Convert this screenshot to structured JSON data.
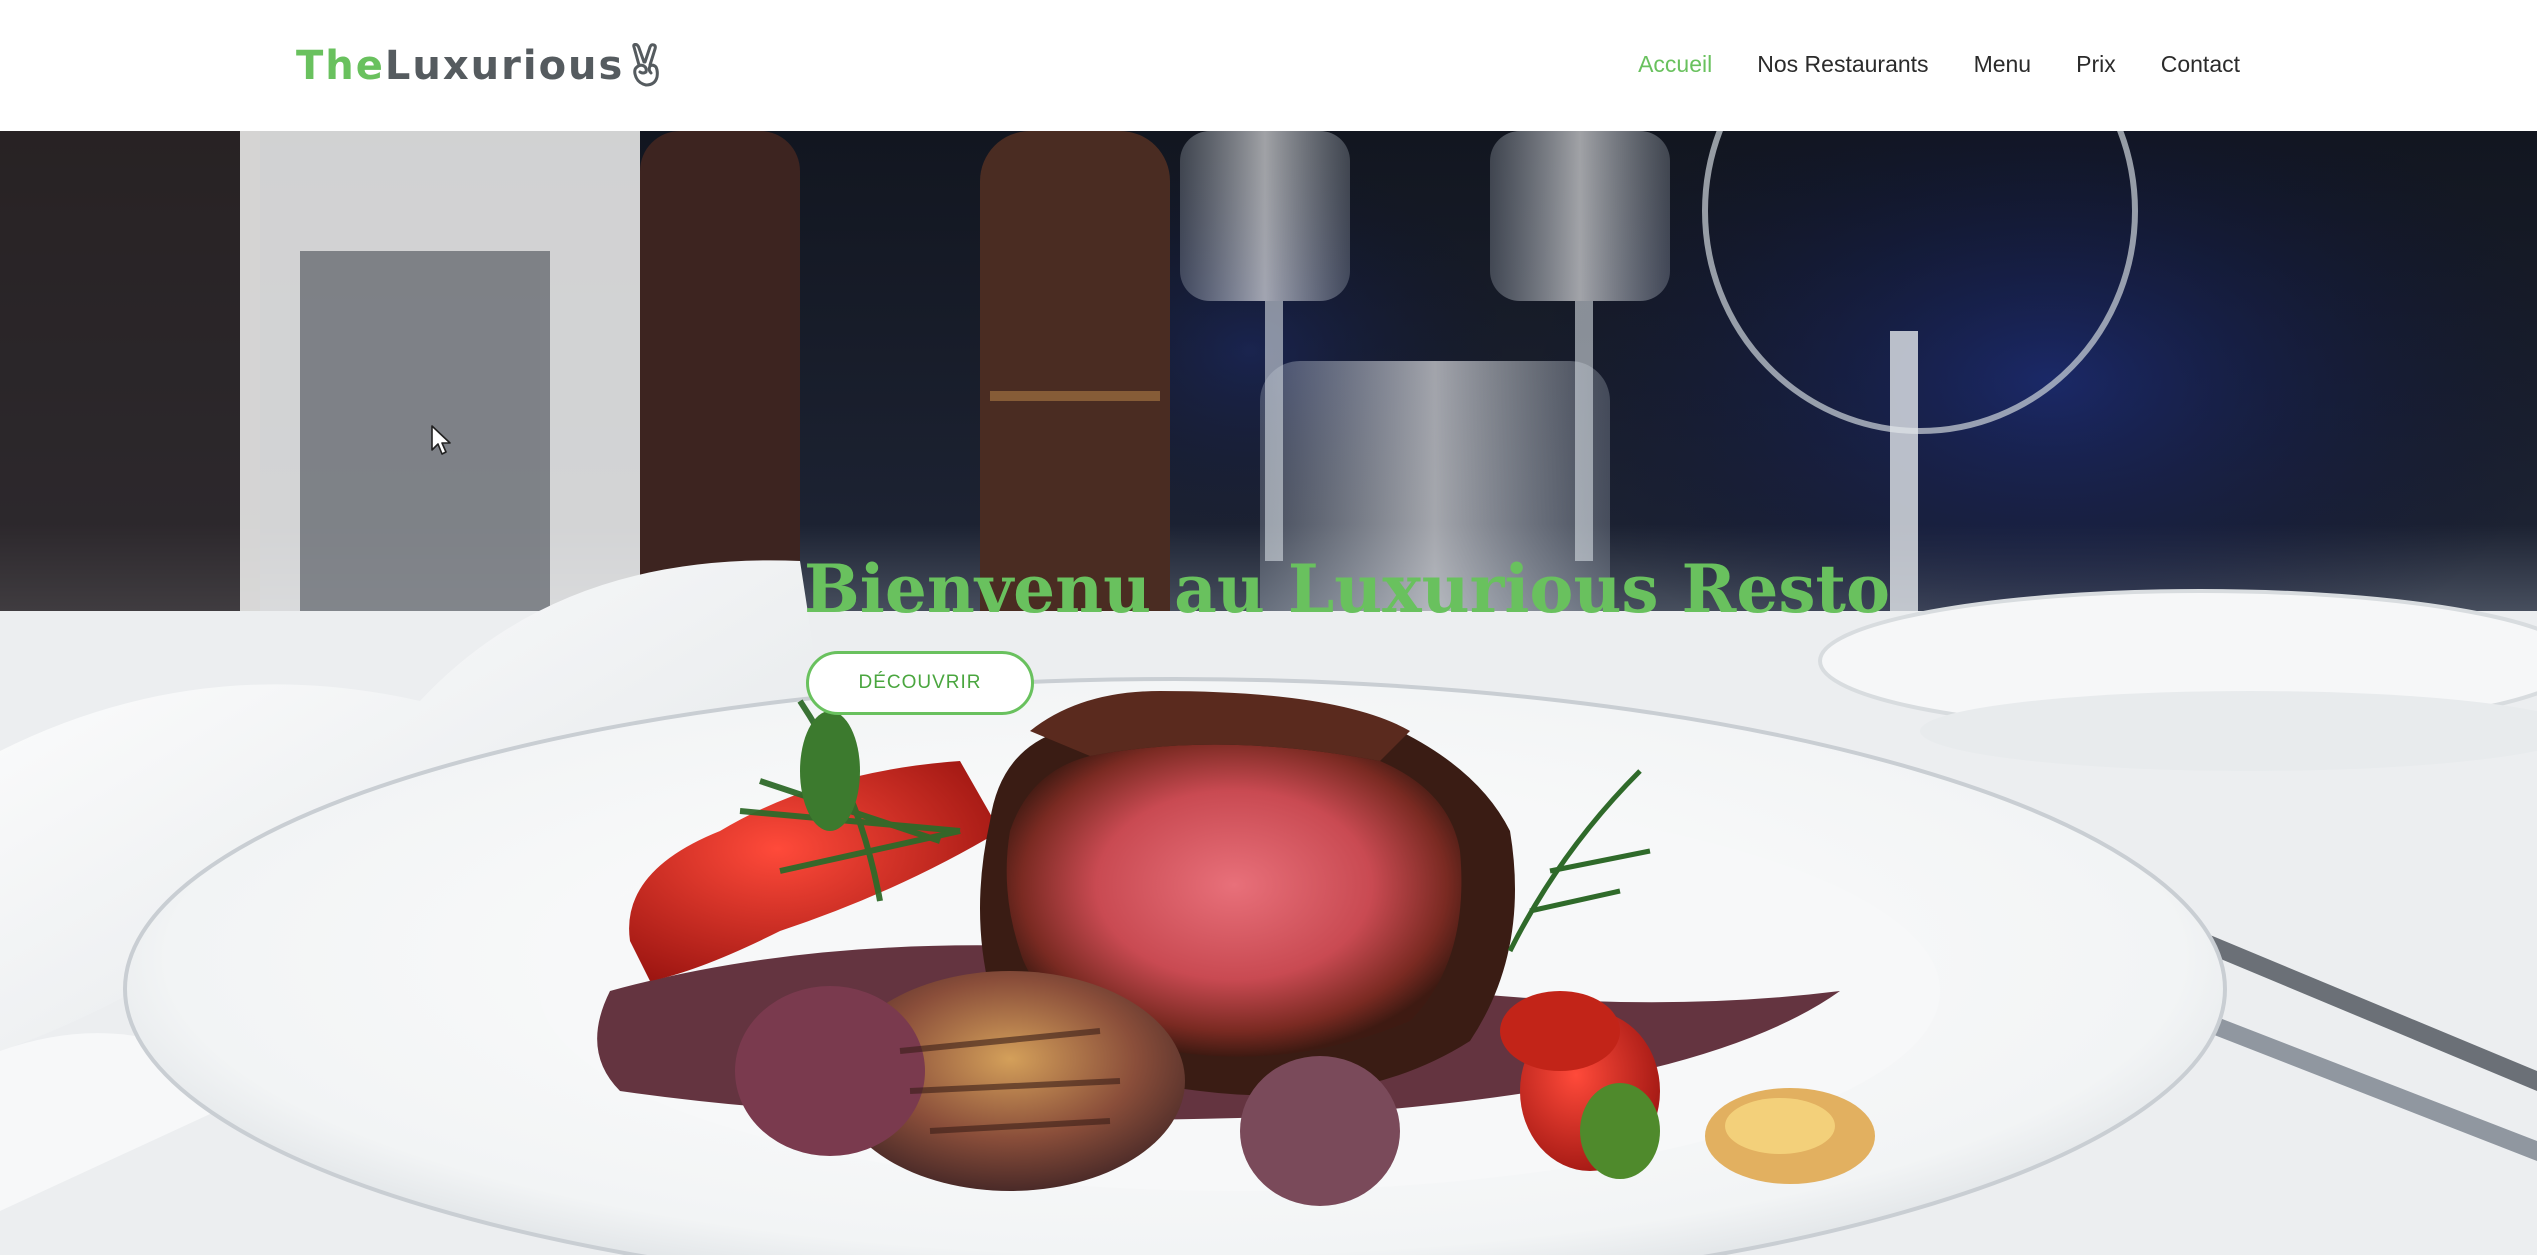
{
  "header": {
    "logo": {
      "accent_text": "The",
      "main_text": "Luxurious",
      "icon": "peace-hand-icon"
    },
    "nav": [
      {
        "label": "Accueil",
        "active": true
      },
      {
        "label": "Nos Restaurants",
        "active": false
      },
      {
        "label": "Menu",
        "active": false
      },
      {
        "label": "Prix",
        "active": false
      },
      {
        "label": "Contact",
        "active": false
      }
    ]
  },
  "hero": {
    "title": "Bienvenu au Luxurious Resto",
    "cta_label": "DÉCOUVRIR",
    "background": "steak-dinner-plate-photo"
  },
  "colors": {
    "accent": "#69c15e",
    "nav_text": "#2b2b2b",
    "logo_text": "#555b5f",
    "header_bg": "#ffffff"
  }
}
